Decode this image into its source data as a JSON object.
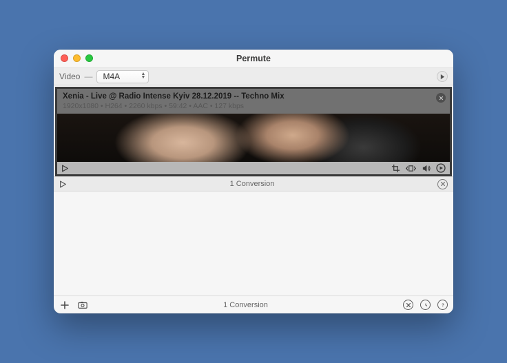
{
  "window": {
    "title": "Permute"
  },
  "toolbar": {
    "source_label": "Video",
    "format_selected": "M4A"
  },
  "item": {
    "title": "Xenia - Live @ Radio Intense Kyiv 28.12.2019 -- Techno Mix",
    "resolution": "1920x1080",
    "vcodec": "H264",
    "vbitrate": "2260 kbps",
    "duration": "59:42",
    "acodec": "AAC",
    "abitrate": "127 kbps"
  },
  "status": {
    "count_label": "1 Conversion"
  },
  "footer": {
    "count_label": "1 Conversion"
  }
}
